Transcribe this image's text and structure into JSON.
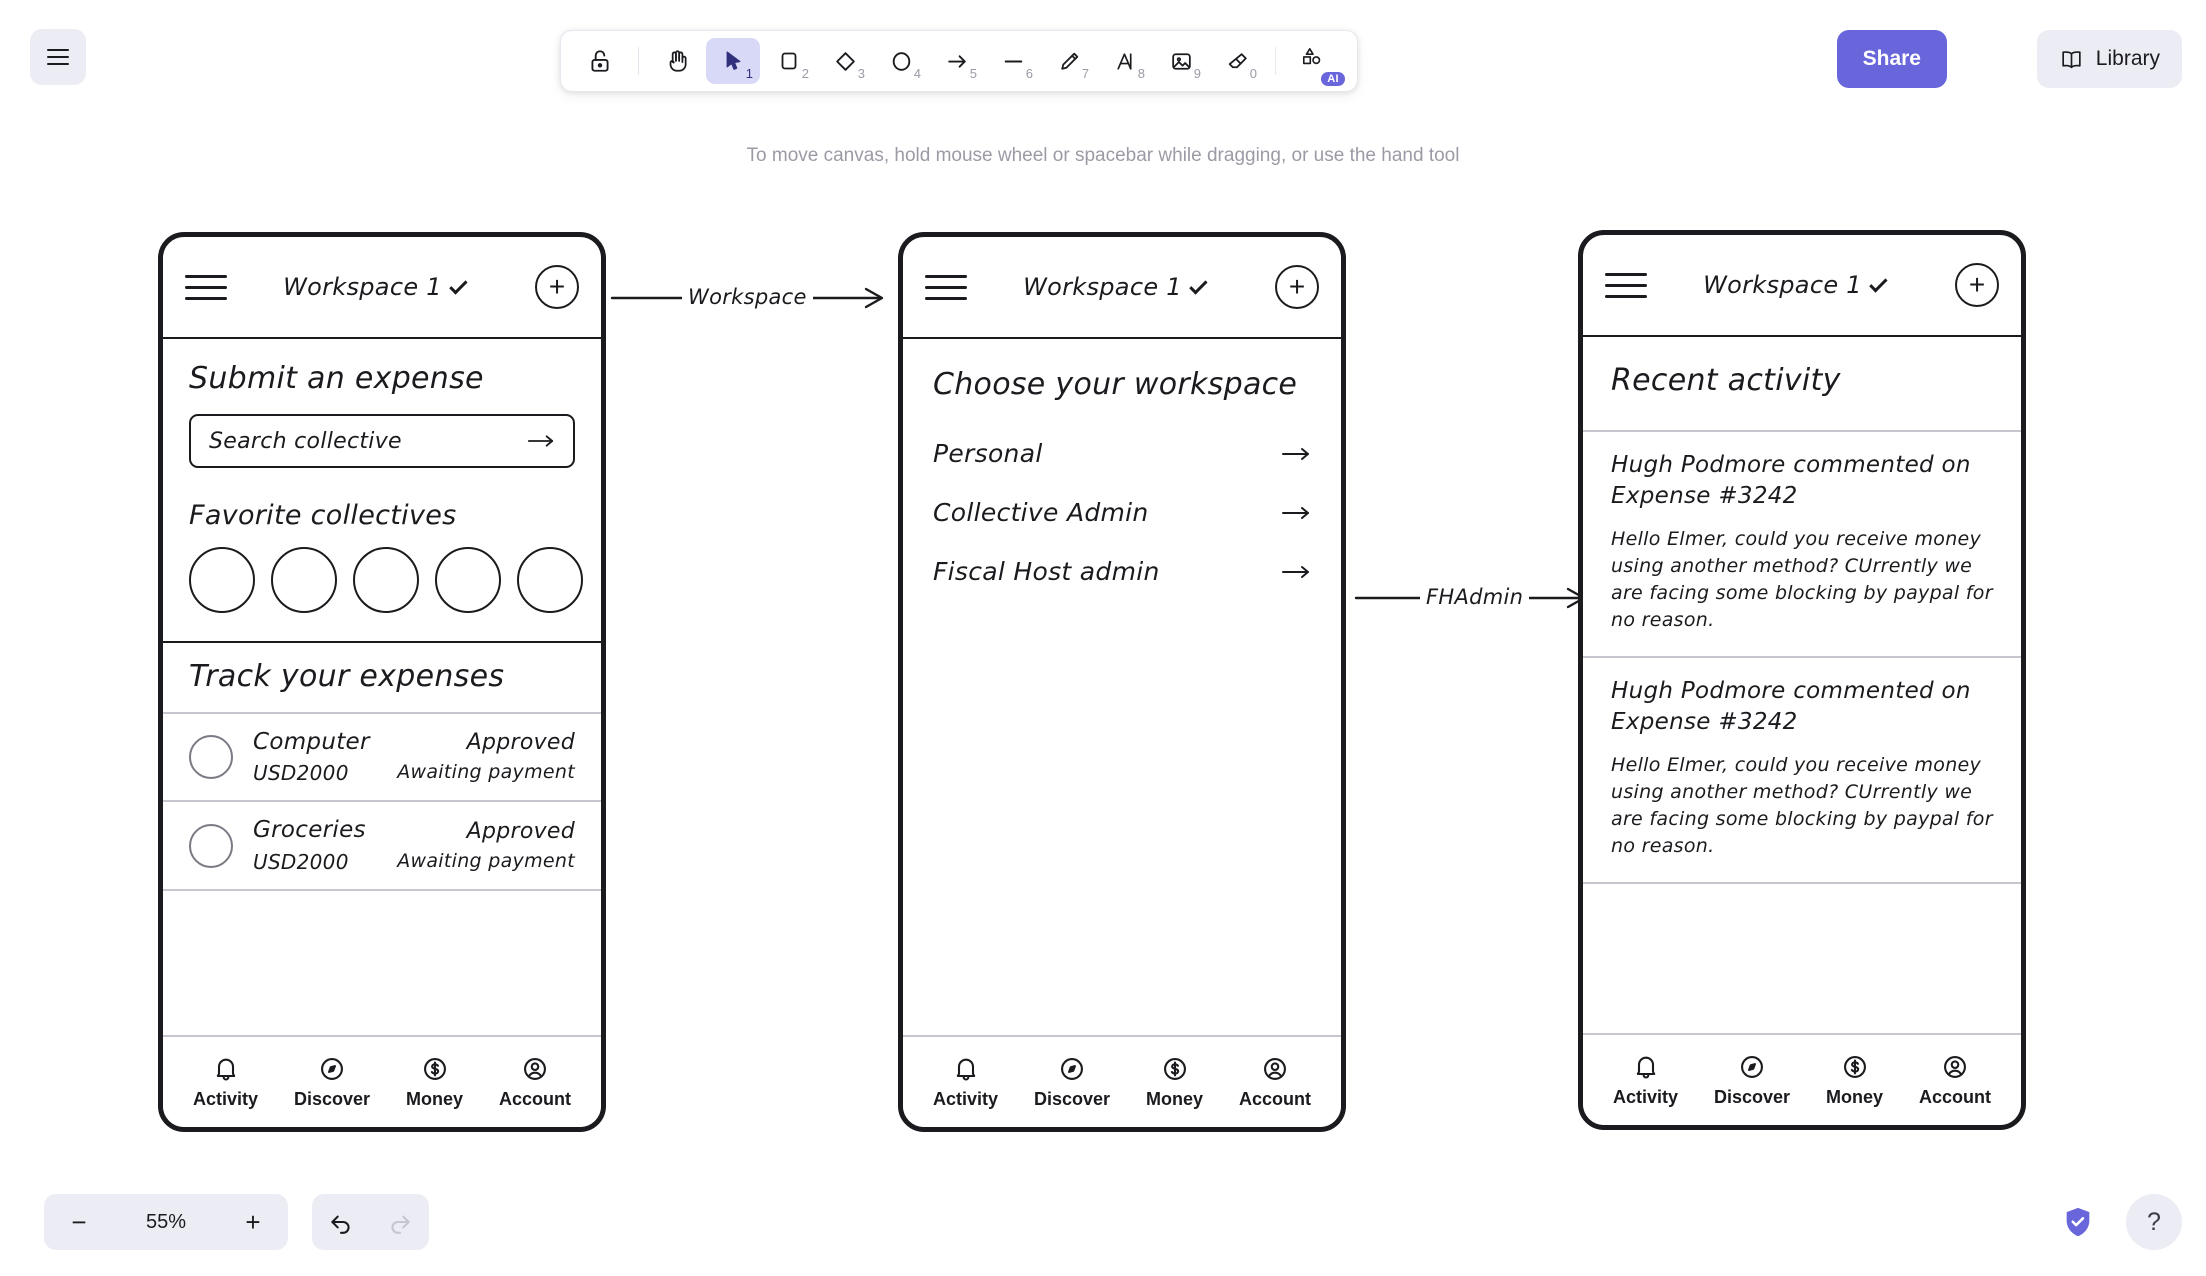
{
  "app": {
    "hint": "To move canvas, hold mouse wheel or spacebar while dragging, or use the hand tool",
    "menu_button": "☰",
    "share_label": "Share",
    "library_label": "Library",
    "zoom_level": "55%",
    "zoom_out": "−",
    "zoom_in": "+",
    "undo": "↩",
    "redo": "↪",
    "help": "?",
    "accent_color": "#6965db",
    "toolbar_bg": "#ffffff",
    "active_tool_bg": "#d7d9f7"
  },
  "toolbar": {
    "tools": [
      {
        "name": "lock-icon",
        "label": "Lock",
        "key": "",
        "active": false
      },
      {
        "name": "hand-icon",
        "label": "Hand",
        "key": "",
        "active": false
      },
      {
        "name": "selection-icon",
        "label": "Selection",
        "key": "1",
        "active": true
      },
      {
        "name": "rectangle-icon",
        "label": "Rectangle",
        "key": "2",
        "active": false
      },
      {
        "name": "diamond-icon",
        "label": "Diamond",
        "key": "3",
        "active": false
      },
      {
        "name": "ellipse-icon",
        "label": "Ellipse",
        "key": "4",
        "active": false
      },
      {
        "name": "arrow-icon",
        "label": "Arrow",
        "key": "5",
        "active": false
      },
      {
        "name": "line-icon",
        "label": "Line",
        "key": "6",
        "active": false
      },
      {
        "name": "pencil-icon",
        "label": "Draw",
        "key": "7",
        "active": false
      },
      {
        "name": "text-icon",
        "label": "Text",
        "key": "8",
        "active": false
      },
      {
        "name": "image-icon",
        "label": "Image",
        "key": "9",
        "active": false
      },
      {
        "name": "eraser-icon",
        "label": "Eraser",
        "key": "0",
        "active": false
      },
      {
        "name": "ai-shapes-icon",
        "label": "AI",
        "key": "",
        "active": false,
        "badge": "AI"
      }
    ]
  },
  "connectors": [
    {
      "label": "Workspace"
    },
    {
      "label": "FHAdmin"
    }
  ],
  "phone1": {
    "header": {
      "workspace": "Workspace 1",
      "add": "+"
    },
    "submit_title": "Submit an expense",
    "search_placeholder": "Search collective",
    "favorites_title": "Favorite collectives",
    "favorites_count": 5,
    "track_title": "Track your expenses",
    "expenses": [
      {
        "name": "Computer",
        "amount": "USD2000",
        "status": "Approved",
        "substatus": "Awaiting payment"
      },
      {
        "name": "Groceries",
        "amount": "USD2000",
        "status": "Approved",
        "substatus": "Awaiting payment"
      }
    ],
    "tabs": [
      {
        "label": "Activity",
        "icon": "bell-icon"
      },
      {
        "label": "Discover",
        "icon": "compass-icon"
      },
      {
        "label": "Money",
        "icon": "dollar-icon"
      },
      {
        "label": "Account",
        "icon": "person-icon"
      }
    ]
  },
  "phone2": {
    "header": {
      "workspace": "Workspace 1",
      "add": "+"
    },
    "title": "Choose your workspace",
    "options": [
      {
        "label": "Personal"
      },
      {
        "label": "Collective Admin"
      },
      {
        "label": "Fiscal Host admin"
      }
    ],
    "tabs": [
      {
        "label": "Activity",
        "icon": "bell-icon"
      },
      {
        "label": "Discover",
        "icon": "compass-icon"
      },
      {
        "label": "Money",
        "icon": "dollar-icon"
      },
      {
        "label": "Account",
        "icon": "person-icon"
      }
    ]
  },
  "phone3": {
    "header": {
      "workspace": "Workspace 1",
      "add": "+"
    },
    "title": "Recent activity",
    "activities": [
      {
        "title": "Hugh Podmore commented on Expense #3242",
        "body": "Hello Elmer, could you receive money using another method? CUrrently we are facing some blocking by paypal for no reason."
      },
      {
        "title": "Hugh Podmore commented on Expense #3242",
        "body": "Hello Elmer, could you receive money using another method? CUrrently we are facing some blocking by paypal for no reason."
      }
    ],
    "tabs": [
      {
        "label": "Activity",
        "icon": "bell-icon"
      },
      {
        "label": "Discover",
        "icon": "compass-icon"
      },
      {
        "label": "Money",
        "icon": "dollar-icon"
      },
      {
        "label": "Account",
        "icon": "person-icon"
      }
    ]
  }
}
